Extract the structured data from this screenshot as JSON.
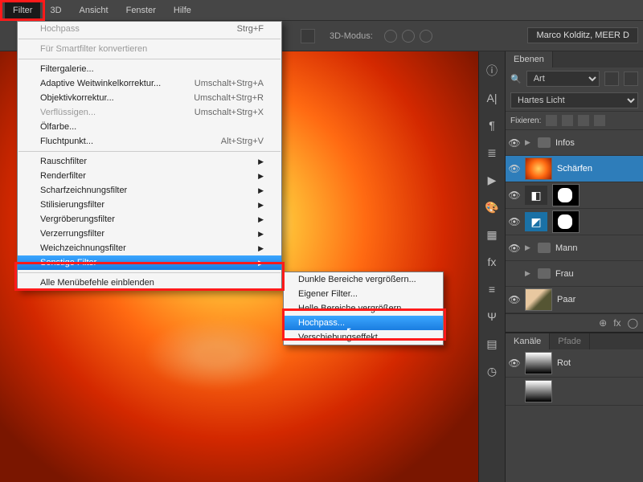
{
  "menubar": [
    "Filter",
    "3D",
    "Ansicht",
    "Fenster",
    "Hilfe"
  ],
  "active_menu_index": 0,
  "toolbar": {
    "mode_label": "3D-Modus:",
    "doc_title": "Marco Kolditz, MEER D"
  },
  "filter_menu": {
    "recent": {
      "label": "Hochpass",
      "shortcut": "Strg+F"
    },
    "smart": "Für Smartfilter konvertieren",
    "items1": [
      {
        "label": "Filtergalerie..."
      },
      {
        "label": "Adaptive Weitwinkelkorrektur...",
        "shortcut": "Umschalt+Strg+A"
      },
      {
        "label": "Objektivkorrektur...",
        "shortcut": "Umschalt+Strg+R"
      },
      {
        "label": "Verflüssigen...",
        "shortcut": "Umschalt+Strg+X",
        "disabled": true
      },
      {
        "label": "Ölfarbe..."
      },
      {
        "label": "Fluchtpunkt...",
        "shortcut": "Alt+Strg+V"
      }
    ],
    "sub_items": [
      "Rauschfilter",
      "Renderfilter",
      "Scharfzeichnungsfilter",
      "Stilisierungsfilter",
      "Vergröberungsfilter",
      "Verzerrungsfilter",
      "Weichzeichnungsfilter",
      "Sonstige Filter"
    ],
    "sub_selected_index": 7,
    "show_all": "Alle Menübefehle einblenden"
  },
  "submenu": {
    "items": [
      "Dunkle Bereiche vergrößern...",
      "Eigener Filter...",
      "Helle Bereiche vergrößern...",
      "Hochpass...",
      "Verschiebungseffekt..."
    ],
    "selected_index": 3
  },
  "layers_panel": {
    "tab": "Ebenen",
    "search_kind": "Art",
    "blend_mode": "Hartes Licht",
    "lock_label": "Fixieren:",
    "layers": [
      {
        "type": "group",
        "name": "Infos"
      },
      {
        "type": "layer",
        "name": "Schärfen",
        "thumb": "fire",
        "selected": true,
        "mask": false
      },
      {
        "type": "adj",
        "name": "",
        "thumb": "bw",
        "icon": "◧"
      },
      {
        "type": "adj",
        "name": "",
        "thumb": "blue",
        "icon": "◩"
      },
      {
        "type": "group",
        "name": "Mann"
      },
      {
        "type": "group",
        "name": "Frau"
      },
      {
        "type": "layer",
        "name": "Paar",
        "thumb": "photo"
      }
    ]
  },
  "channels_panel": {
    "tabs": [
      "Kanäle",
      "Pfade"
    ],
    "channels": [
      {
        "name": "Rot"
      },
      {
        "name": ""
      }
    ]
  }
}
